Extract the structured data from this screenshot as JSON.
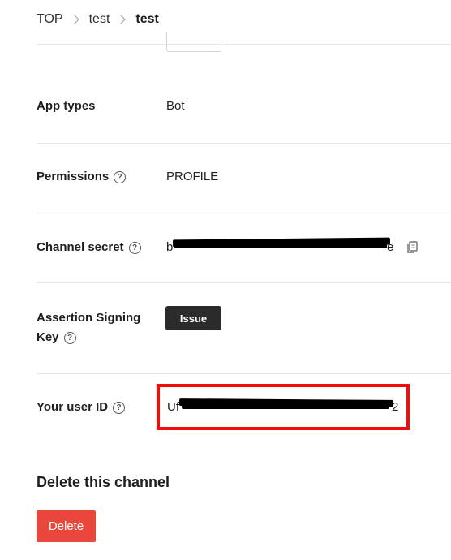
{
  "breadcrumb": {
    "items": [
      "TOP",
      "test",
      "test"
    ]
  },
  "fields": {
    "app_types": {
      "label": "App types",
      "value": "Bot"
    },
    "permissions": {
      "label": "Permissions",
      "value": "PROFILE"
    },
    "channel_secret": {
      "label": "Channel secret",
      "value_visible_start": "b",
      "value_visible_end": "e"
    },
    "assertion_key": {
      "label_line1": "Assertion Signing",
      "label_line2": "Key",
      "button": "Issue"
    },
    "user_id": {
      "label": "Your user ID",
      "value_visible_start": "Uf",
      "value_visible_end": "2"
    }
  },
  "help_glyph": "?",
  "delete_section": {
    "title": "Delete this channel",
    "button": "Delete"
  },
  "colors": {
    "highlight": "#f40c0c",
    "delete": "#e9473c",
    "issue": "#2b2b2b"
  },
  "icons": {
    "copy": "copy-icon",
    "help": "help-circle-icon",
    "chevron": "chevron-right-icon"
  }
}
